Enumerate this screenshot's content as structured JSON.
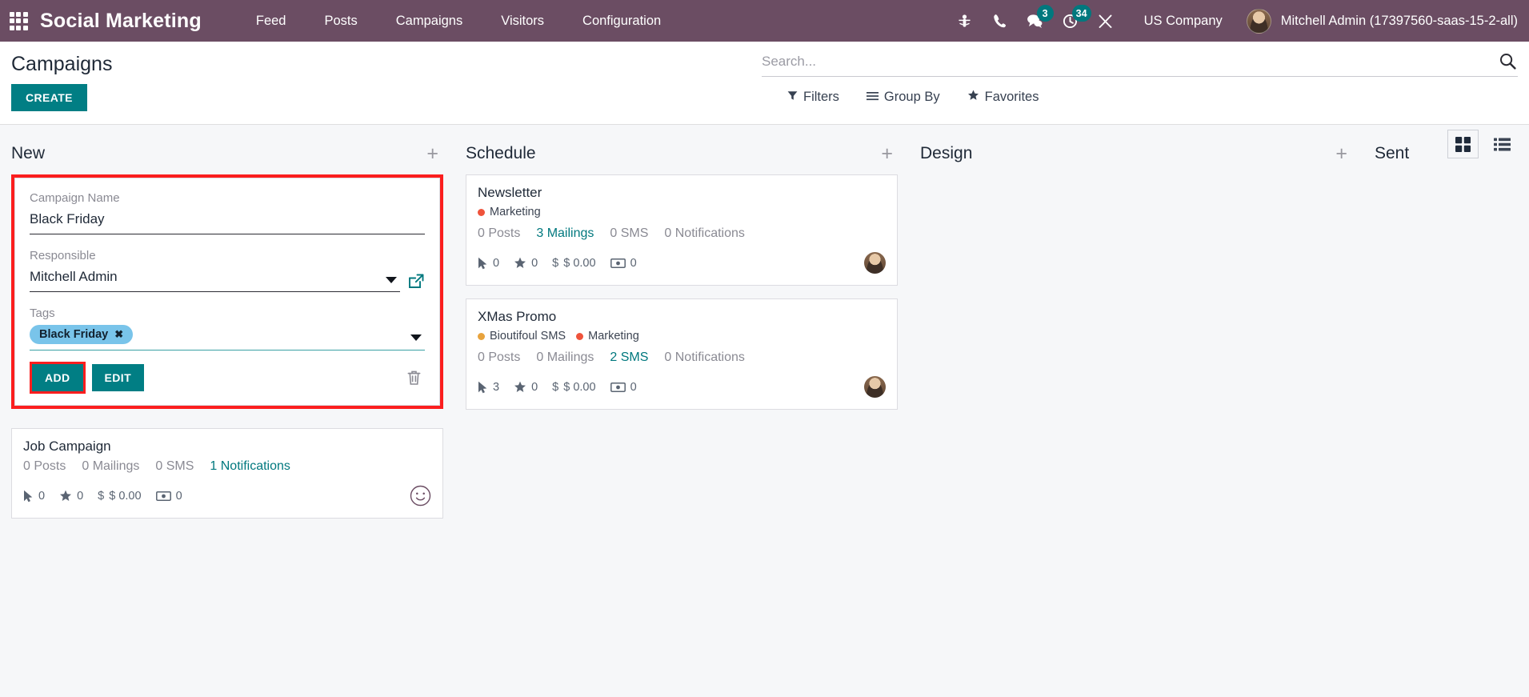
{
  "navbar": {
    "apps_icon": "apps-grid-icon",
    "brand": "Social Marketing",
    "links": [
      {
        "label": "Feed"
      },
      {
        "label": "Posts"
      },
      {
        "label": "Campaigns"
      },
      {
        "label": "Visitors"
      },
      {
        "label": "Configuration"
      }
    ],
    "sys_icons": [
      {
        "name": "bug-icon",
        "badge": null
      },
      {
        "name": "phone-icon",
        "badge": null
      },
      {
        "name": "messages-icon",
        "badge": "3"
      },
      {
        "name": "activities-clock-icon",
        "badge": "34"
      },
      {
        "name": "tools-icon",
        "badge": null
      }
    ],
    "company": "US Company",
    "user": "Mitchell Admin (17397560-saas-15-2-all)",
    "bg_color": "#6b4d63",
    "badge_color": "#00787e"
  },
  "control_panel": {
    "title": "Campaigns",
    "create_label": "CREATE",
    "create_color": "#017e84",
    "search": {
      "value": "",
      "placeholder": "Search...",
      "icon": "search-icon"
    },
    "filters": [
      {
        "label": "Filters",
        "icon": "funnel-icon"
      },
      {
        "label": "Group By",
        "icon": "bars-icon"
      },
      {
        "label": "Favorites",
        "icon": "star-icon"
      }
    ],
    "views": [
      {
        "name": "kanban",
        "icon": "kanban-view-icon",
        "active": true
      },
      {
        "name": "list",
        "icon": "list-view-icon",
        "active": false
      }
    ]
  },
  "kanban": {
    "add_icon": "plus-icon",
    "columns": [
      {
        "title": "New"
      },
      {
        "title": "Schedule"
      },
      {
        "title": "Design"
      },
      {
        "title": "Sent"
      }
    ]
  },
  "quick_create": {
    "highlighted": true,
    "highlight_color": "#fb1e1e",
    "name_label": "Campaign Name",
    "name_value": "Black Friday",
    "responsible_label": "Responsible",
    "responsible_value": "Mitchell Admin",
    "responsible_dropdown_icon": "chevron-down-icon",
    "external_link_icon": "external-link-icon",
    "tags_label": "Tags",
    "tags": [
      {
        "label": "Black Friday",
        "color": "#79c4ea",
        "remove_icon": "close-icon"
      }
    ],
    "tags_dropdown_icon": "chevron-down-icon",
    "add_label": "ADD",
    "edit_label": "EDIT",
    "delete_icon": "trash-icon"
  },
  "cards": {
    "new": [
      {
        "title": "Job Campaign",
        "tags": [],
        "stats": [
          {
            "label": "0 Posts",
            "link": false
          },
          {
            "label": "0 Mailings",
            "link": false
          },
          {
            "label": "0 SMS",
            "link": false
          },
          {
            "label": "1 Notifications",
            "link": true
          }
        ],
        "metrics": [
          {
            "icon": "mouse-pointer-icon",
            "value": "0"
          },
          {
            "icon": "star-icon",
            "value": "0"
          },
          {
            "icon": "dollar-icon",
            "value": "$ 0.00"
          },
          {
            "icon": "money-bill-icon",
            "value": "0"
          }
        ],
        "avatar": "smiley-placeholder-avatar"
      }
    ],
    "schedule": [
      {
        "title": "Newsletter",
        "tags": [
          {
            "label": "Marketing",
            "color": "#ef533b"
          }
        ],
        "stats": [
          {
            "label": "0 Posts",
            "link": false
          },
          {
            "label": "3 Mailings",
            "link": true
          },
          {
            "label": "0 SMS",
            "link": false
          },
          {
            "label": "0 Notifications",
            "link": false
          }
        ],
        "metrics": [
          {
            "icon": "mouse-pointer-icon",
            "value": "0"
          },
          {
            "icon": "star-icon",
            "value": "0"
          },
          {
            "icon": "dollar-icon",
            "value": "$ 0.00"
          },
          {
            "icon": "money-bill-icon",
            "value": "0"
          }
        ],
        "avatar": "user-photo-avatar"
      },
      {
        "title": "XMas Promo",
        "tags": [
          {
            "label": "Bioutifoul SMS",
            "color": "#e8a33d"
          },
          {
            "label": "Marketing",
            "color": "#ef533b"
          }
        ],
        "stats": [
          {
            "label": "0 Posts",
            "link": false
          },
          {
            "label": "0 Mailings",
            "link": false
          },
          {
            "label": "2 SMS",
            "link": true
          },
          {
            "label": "0 Notifications",
            "link": false
          }
        ],
        "metrics": [
          {
            "icon": "mouse-pointer-icon",
            "value": "3"
          },
          {
            "icon": "star-icon",
            "value": "0"
          },
          {
            "icon": "dollar-icon",
            "value": "$ 0.00"
          },
          {
            "icon": "money-bill-icon",
            "value": "0"
          }
        ],
        "avatar": "user-photo-avatar"
      }
    ],
    "design": [],
    "sent": []
  }
}
